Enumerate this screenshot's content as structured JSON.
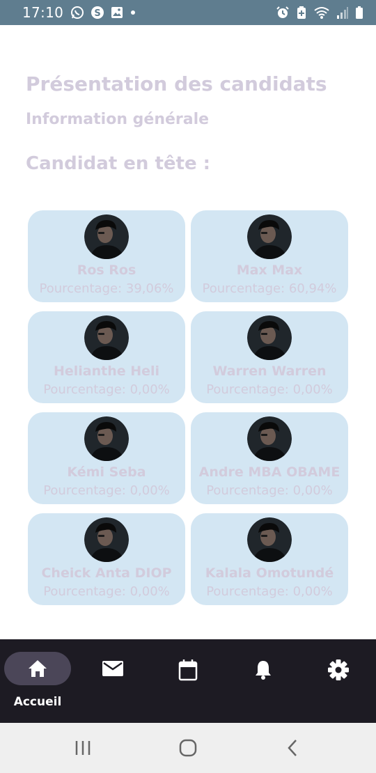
{
  "status_bar": {
    "time": "17:10",
    "left_icons": [
      "whatsapp-icon",
      "skype-icon",
      "image-icon",
      "dot-icon"
    ],
    "right_icons": [
      "alarm-icon",
      "battery-saver-icon",
      "wifi-icon",
      "signal-icon",
      "battery-icon"
    ]
  },
  "header": {
    "title": "Présentation des candidats",
    "subtitle": "Information générale",
    "leader_label": "Candidat en tête :"
  },
  "candidates": [
    {
      "name": "Ros Ros",
      "percentage": "Pourcentage: 39,06%"
    },
    {
      "name": "Max Max",
      "percentage": "Pourcentage: 60,94%"
    },
    {
      "name": "Helianthe Heli",
      "percentage": "Pourcentage: 0,00%"
    },
    {
      "name": "Warren Warren",
      "percentage": "Pourcentage: 0,00%"
    },
    {
      "name": "Kémi Seba",
      "percentage": "Pourcentage: 0,00%"
    },
    {
      "name": "Andre MBA OBAME",
      "percentage": "Pourcentage: 0,00%"
    },
    {
      "name": "Cheick Anta DIOP",
      "percentage": "Pourcentage: 0,00%"
    },
    {
      "name": "Kalala Omotundé",
      "percentage": "Pourcentage: 0,00%"
    }
  ],
  "bottom_nav": {
    "items": [
      {
        "icon": "home-icon",
        "label": "Accueil",
        "active": true
      },
      {
        "icon": "mail-icon",
        "label": ""
      },
      {
        "icon": "calendar-icon",
        "label": ""
      },
      {
        "icon": "bell-icon",
        "label": ""
      },
      {
        "icon": "gear-icon",
        "label": ""
      }
    ]
  },
  "system_nav": [
    "recents-icon",
    "home-circle-icon",
    "back-icon"
  ],
  "colors": {
    "status_bar": "#5f7d8f",
    "heading_text": "#d2cbdc",
    "card_background": "#d3e6f3",
    "bottom_nav": "#1d1b23",
    "active_pill": "#4b4658",
    "system_nav": "#efefef"
  }
}
